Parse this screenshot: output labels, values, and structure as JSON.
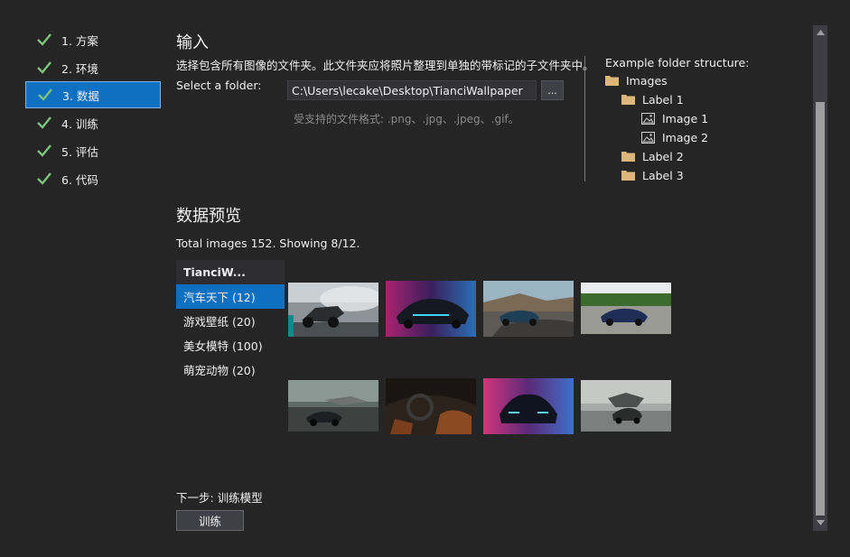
{
  "steps": [
    {
      "label": "1. 方案"
    },
    {
      "label": "2. 环境"
    },
    {
      "label": "3. 数据"
    },
    {
      "label": "4. 训练"
    },
    {
      "label": "5. 评估"
    },
    {
      "label": "6. 代码"
    }
  ],
  "input_section": {
    "title": "输入",
    "description": "选择包含所有图像的文件夹。此文件夹应将照片整理到单独的带标记的子文件夹中。",
    "select_label": "Select a folder:",
    "folder_path": "C:\\Users\\lecake\\Desktop\\TianciWallpaper",
    "browse_label": "...",
    "formats_hint": "受支持的文件格式: .png、.jpg、.jpeg、.gif。"
  },
  "example": {
    "title": "Example folder structure:",
    "tree": [
      {
        "label": "Images",
        "icon": "folder-icon"
      },
      {
        "label": "Label 1",
        "icon": "folder-icon"
      },
      {
        "label": "Image 1",
        "icon": "image-icon"
      },
      {
        "label": "Image 2",
        "icon": "image-icon"
      },
      {
        "label": "Label 2",
        "icon": "folder-icon"
      },
      {
        "label": "Label 3",
        "icon": "folder-icon"
      }
    ]
  },
  "preview": {
    "title": "数据预览",
    "summary": "Total images 152. Showing 8/12.",
    "folder_name": "TianciW...",
    "categories": [
      {
        "label": "汽车天下 (12)"
      },
      {
        "label": "游戏壁纸 (20)"
      },
      {
        "label": "美女模特 (100)"
      },
      {
        "label": "萌宠动物 (20)"
      }
    ]
  },
  "next_step": {
    "label": "下一步: 训练模型",
    "button_label": "训练"
  },
  "colors": {
    "background": "#252526",
    "accent": "#0e70c0",
    "check": "#7cc47c",
    "folder": "#dcb67a"
  }
}
